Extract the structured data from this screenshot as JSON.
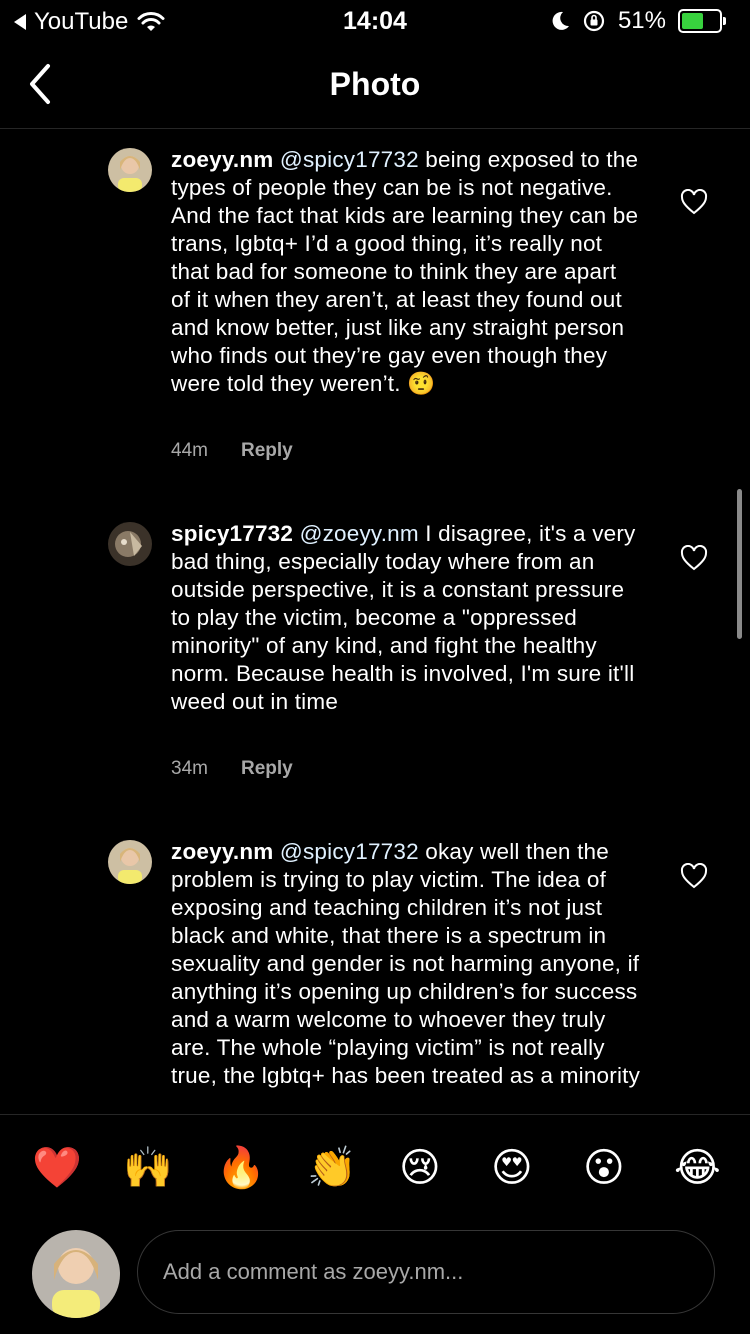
{
  "status_bar": {
    "back_app": "YouTube",
    "time": "14:04",
    "battery": "51%"
  },
  "nav": {
    "title": "Photo"
  },
  "comments": [
    {
      "username": "zoeyy.nm",
      "mention": "@spicy17732",
      "body": " being exposed to the types of people they can be is not negative. And the fact that kids are learning they can be trans, lgbtq+ I’d a good thing, it’s really not that bad for someone to think they are apart of it when they aren’t, at least they found out and know better, just like any straight person who finds out they’re gay even though they were told they weren’t. 🤨",
      "time": "44m",
      "reply": "Reply"
    },
    {
      "username": "spicy17732",
      "mention": "@zoeyy.nm",
      "body": " I disagree, it's a very bad thing, especially today where from an outside perspective, it is a constant pressure to play the victim, become a \"oppressed minority\" of any kind, and fight the healthy norm. Because health is involved, I'm sure it'll weed out in time",
      "time": "34m",
      "reply": "Reply"
    },
    {
      "username": "zoeyy.nm",
      "mention": "@spicy17732",
      "body": " okay well then the problem is trying to play victim. The idea of exposing and teaching children it’s not just black and white, that there is a spectrum in sexuality and gender is not harming anyone, if anything it’s opening up children’s for success and a warm welcome to whoever they truly are. The whole “playing victim” is not really true, the lgbtq+ has been treated as a minority",
      "time": "",
      "reply": ""
    }
  ],
  "reactions": [
    "❤️",
    "🙌",
    "🔥",
    "👏",
    "😢",
    "😍",
    "😮",
    "😂"
  ],
  "comment_input": {
    "placeholder": "Add a comment as zoeyy.nm..."
  },
  "icons": {
    "back": "chevron-left-icon",
    "like": "heart-outline-icon",
    "wifi": "wifi-icon",
    "dnd": "moon-icon",
    "orientation_lock": "rotation-lock-icon",
    "battery": "battery-charging-icon"
  },
  "colors": {
    "background": "#000000",
    "text": "#ffffff",
    "secondary_text": "#a8a8a8",
    "mention": "#e0f1ff",
    "battery_fill": "#38d13e"
  }
}
